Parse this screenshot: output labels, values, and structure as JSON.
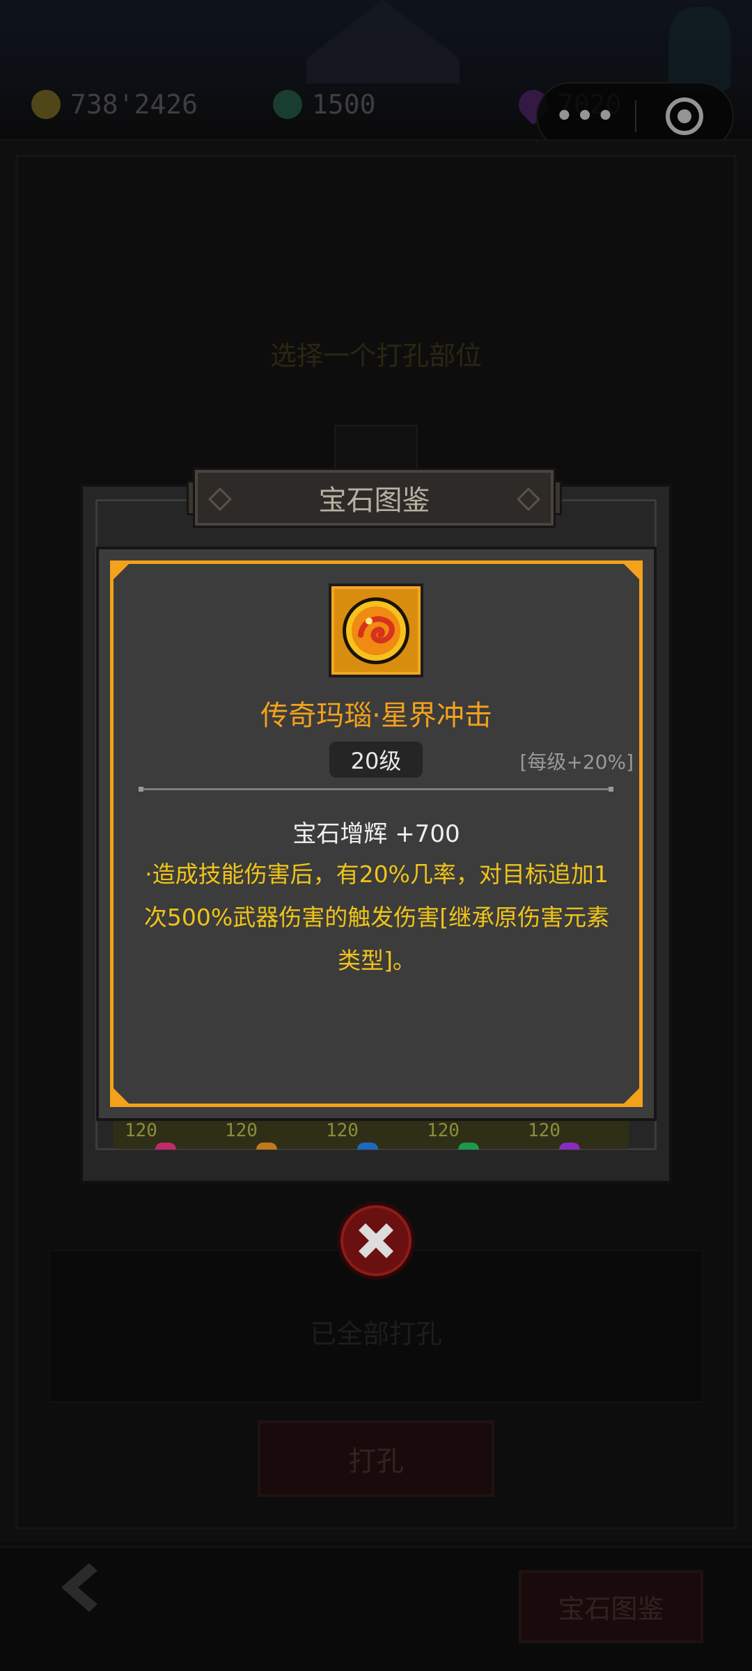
{
  "currencies": {
    "gold": {
      "icon": "gold-coin-icon",
      "value": "738'2426"
    },
    "energy": {
      "icon": "swirl-energy-icon",
      "value": "1500"
    },
    "gem": {
      "icon": "purple-gem-icon",
      "value": "7020"
    }
  },
  "capsule": {
    "more_label": "•••",
    "more_icon": "more-dots-icon",
    "target_icon": "target-icon"
  },
  "background": {
    "select_title": "选择一个打孔部位",
    "all_drilled_text": "已全部打孔",
    "drill_button": "打孔",
    "gem_guide_button": "宝石图鉴"
  },
  "modal": {
    "title": "宝石图鉴",
    "gem_icon": "agate-gem-icon",
    "gem_name": "传奇玛瑙·星界冲击",
    "level": "20级",
    "per_level": "[每级+20%]",
    "stat": "宝石增辉 +700",
    "effect": "·造成技能伤害后，有20%几率，对目标追加1次500%武器伤害的触发伤害[继承原伤害元素类型]。",
    "gem_levels": [
      "120",
      "120",
      "120",
      "120",
      "120"
    ]
  },
  "colors": {
    "accent_orange": "#f2a21c",
    "effect_yellow": "#f0c419",
    "close_red": "#6b1010"
  }
}
